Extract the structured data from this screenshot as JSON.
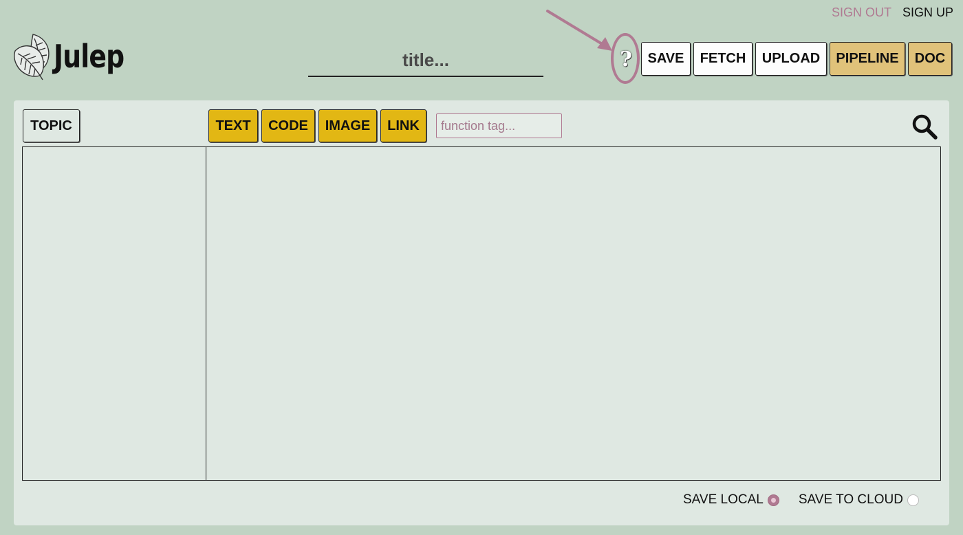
{
  "auth": {
    "sign_out": "SIGN OUT",
    "sign_up": "SIGN UP"
  },
  "logo": {
    "name": "Julep",
    "icon": "leaf-icon"
  },
  "title": {
    "placeholder": "title..."
  },
  "help": {
    "label": "?",
    "icon": "help-icon"
  },
  "toolbar": {
    "save": "SAVE",
    "fetch": "FETCH",
    "upload": "UPLOAD",
    "pipeline": "PIPELINE",
    "doc": "DOC"
  },
  "panel": {
    "topic": "TOPIC",
    "types": [
      "TEXT",
      "CODE",
      "IMAGE",
      "LINK"
    ],
    "tag_placeholder": "function tag...",
    "search_icon": "search-icon"
  },
  "footer": {
    "save_local": "SAVE LOCAL",
    "save_local_selected": true,
    "save_cloud": "SAVE TO CLOUD",
    "save_cloud_selected": false
  },
  "colors": {
    "background": "#c0d3c3",
    "panel": "#dfe8e2",
    "accent_yellow": "#e2b714",
    "accent_tan": "#e0c27a",
    "annotation": "#b07a92"
  }
}
